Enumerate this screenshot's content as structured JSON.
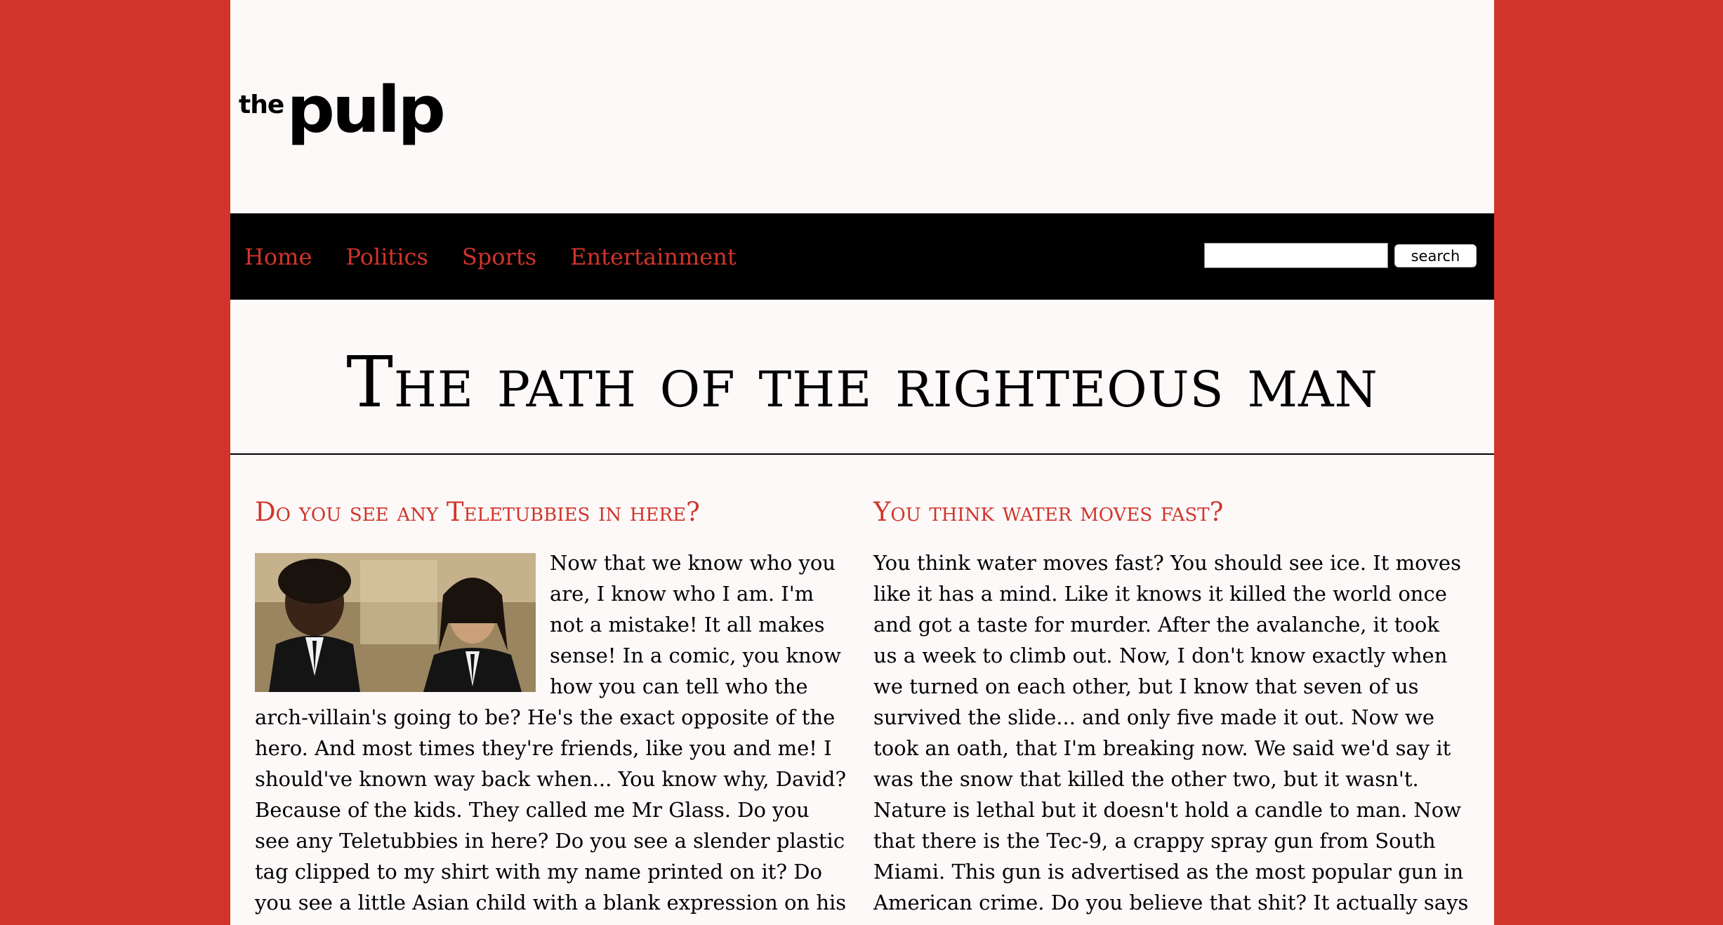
{
  "header": {
    "logo_small": "the",
    "logo_large": "pulp"
  },
  "nav": {
    "items": [
      {
        "label": "Home"
      },
      {
        "label": "Politics"
      },
      {
        "label": "Sports"
      },
      {
        "label": "Entertainment"
      }
    ],
    "search": {
      "value": "",
      "button_label": "search"
    }
  },
  "main": {
    "title": "The path of the righteous man",
    "columns": [
      {
        "heading": "Do you see any Teletubbies in here?",
        "body": "Now that we know who you are, I know who I am. I'm not a mistake! It all makes sense! In a comic, you know how you can tell who the arch-villain's going to be? He's the exact opposite of the hero. And most times they're friends, like you and me! I should've known way back when... You know why, David? Because of the kids. They called me Mr Glass. Do you see any Teletubbies in here? Do you see a slender plastic tag clipped to my shirt with my name printed on it? Do you see a little Asian child with a blank expression on his face"
      },
      {
        "heading": "You think water moves fast?",
        "body": "You think water moves fast? You should see ice. It moves like it has a mind. Like it knows it killed the world once and got a taste for murder. After the avalanche, it took us a week to climb out. Now, I don't know exactly when we turned on each other, but I know that seven of us survived the slide... and only five made it out. Now we took an oath, that I'm breaking now. We said we'd say it was the snow that killed the other two, but it wasn't. Nature is lethal but it doesn't hold a candle to man. Now that there is the Tec-9, a crappy spray gun from South Miami. This gun is advertised as the most popular gun in American crime. Do you believe that shit? It actually says that in the little book"
      }
    ]
  },
  "colors": {
    "accent": "#d1342b",
    "nav_background": "#000000",
    "page_background": "#fcf9f8"
  }
}
